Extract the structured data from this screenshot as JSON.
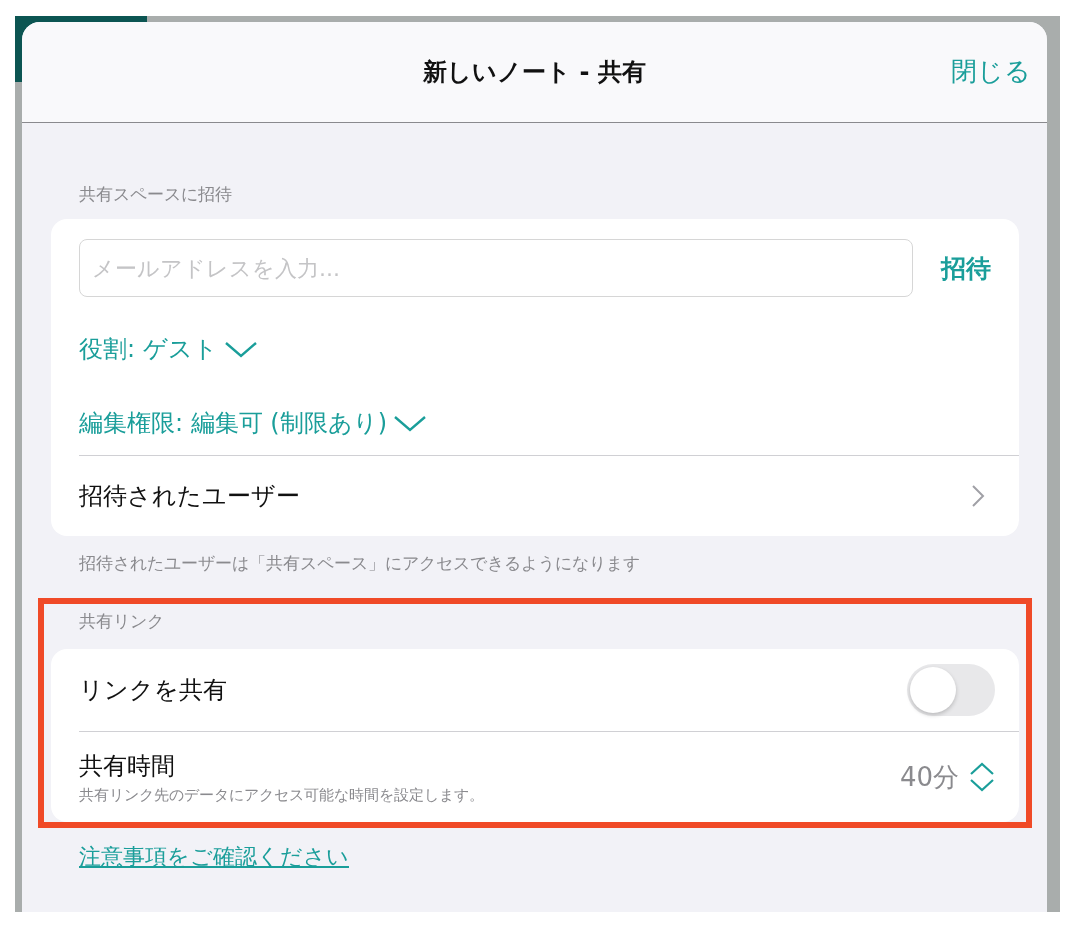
{
  "window": {
    "title": "新しいノート - 共有",
    "close_label": "閉じる"
  },
  "invite_section": {
    "header": "共有スペースに招待",
    "email_field": {
      "placeholder": "メールアドレスを入力..."
    },
    "invite_button": "招待",
    "role": "役割: ゲスト",
    "edit_permission": "編集権限: 編集可 (制限あり)",
    "invited_users": "招待されたユーザー",
    "footer": "招待されたユーザーは「共有スペース」にアクセスできるようになります"
  },
  "link_section": {
    "header": "共有リンク",
    "highlighted": true,
    "share_link": {
      "label": "リンクを共有",
      "on": false
    },
    "share_time": {
      "label": "共有時間",
      "description": "共有リンク先のデータにアクセス可能な時間を設定します。",
      "value": "40分"
    }
  },
  "notice_link": "注意事項をご確認ください"
}
